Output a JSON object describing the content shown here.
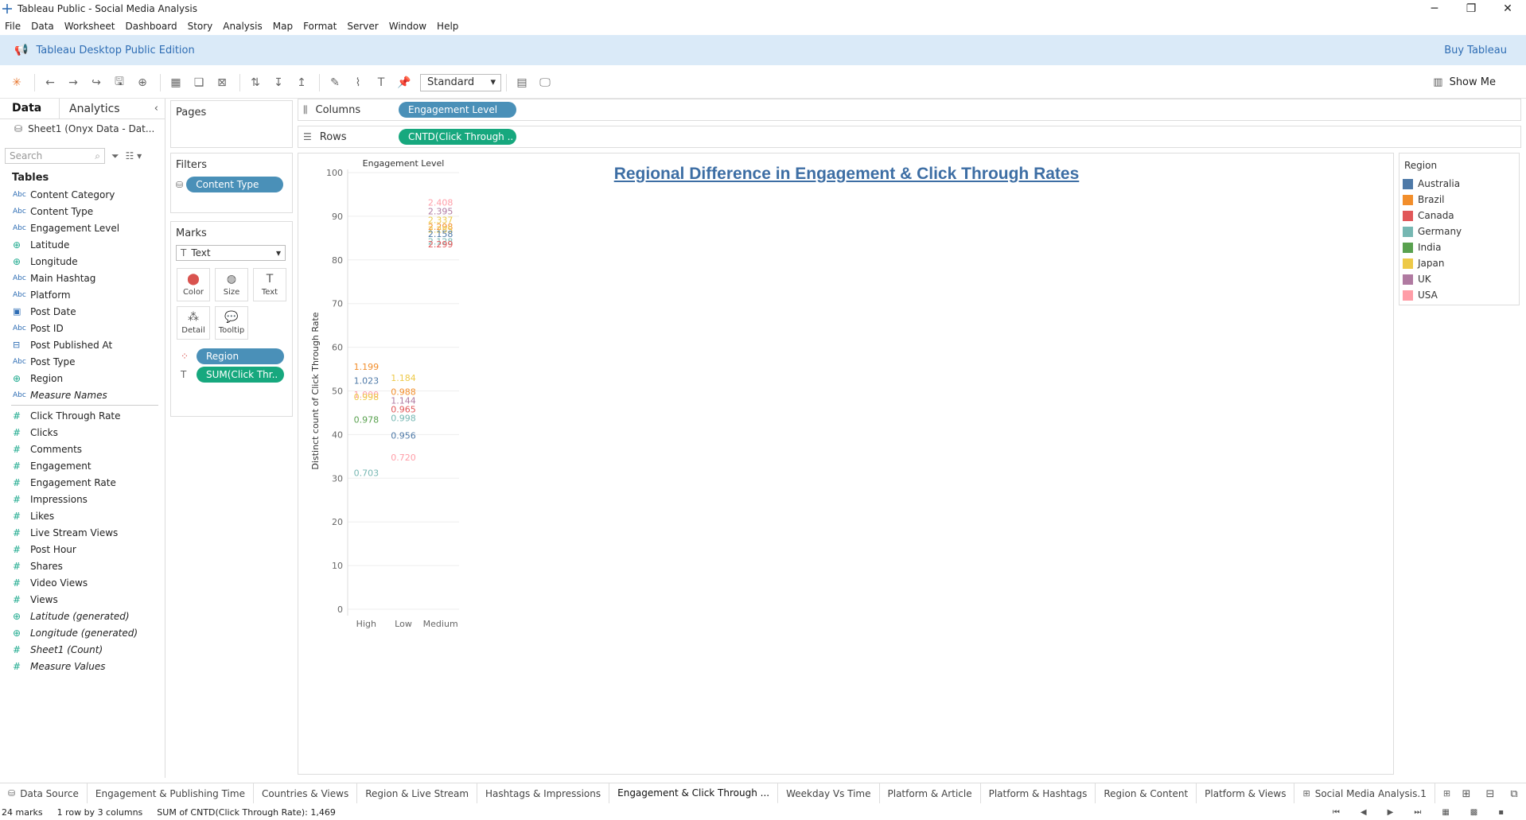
{
  "window": {
    "title": "Tableau Public - Social Media Analysis"
  },
  "menu": [
    "File",
    "Data",
    "Worksheet",
    "Dashboard",
    "Story",
    "Analysis",
    "Map",
    "Format",
    "Server",
    "Window",
    "Help"
  ],
  "banner": {
    "edition": "Tableau Desktop Public Edition",
    "buy": "Buy Tableau"
  },
  "toolbar": {
    "fit": "Standard",
    "show_me": "Show Me"
  },
  "left_pane": {
    "tab_data": "Data",
    "tab_analytics": "Analytics",
    "data_source": "Sheet1 (Onyx Data - Dat...",
    "search_placeholder": "Search",
    "tables_heading": "Tables",
    "dimensions": [
      {
        "type": "Abc",
        "name": "Content Category"
      },
      {
        "type": "Abc",
        "name": "Content Type"
      },
      {
        "type": "Abc",
        "name": "Engagement Level"
      },
      {
        "type": "geo",
        "name": "Latitude"
      },
      {
        "type": "geo",
        "name": "Longitude"
      },
      {
        "type": "Abc",
        "name": "Main Hashtag"
      },
      {
        "type": "Abc",
        "name": "Platform"
      },
      {
        "type": "date",
        "name": "Post Date"
      },
      {
        "type": "Abc",
        "name": "Post ID"
      },
      {
        "type": "datetime",
        "name": "Post Published At"
      },
      {
        "type": "Abc",
        "name": "Post Type"
      },
      {
        "type": "geo",
        "name": "Region"
      },
      {
        "type": "Abc",
        "name": "Measure Names",
        "italic": true
      }
    ],
    "measures": [
      {
        "type": "num",
        "name": "Click Through Rate"
      },
      {
        "type": "num",
        "name": "Clicks"
      },
      {
        "type": "num",
        "name": "Comments"
      },
      {
        "type": "num",
        "name": "Engagement"
      },
      {
        "type": "num",
        "name": "Engagement Rate"
      },
      {
        "type": "num",
        "name": "Impressions"
      },
      {
        "type": "num",
        "name": "Likes"
      },
      {
        "type": "num",
        "name": "Live Stream Views"
      },
      {
        "type": "num",
        "name": "Post Hour"
      },
      {
        "type": "num",
        "name": "Shares"
      },
      {
        "type": "num",
        "name": "Video Views"
      },
      {
        "type": "num",
        "name": "Views"
      },
      {
        "type": "geo",
        "name": "Latitude (generated)",
        "italic": true
      },
      {
        "type": "geo",
        "name": "Longitude (generated)",
        "italic": true
      },
      {
        "type": "num",
        "name": "Sheet1 (Count)",
        "italic": true
      },
      {
        "type": "num",
        "name": "Measure Values",
        "italic": true
      }
    ]
  },
  "pages": {
    "label": "Pages"
  },
  "filters": {
    "label": "Filters",
    "pill": "Content Type"
  },
  "marks": {
    "label": "Marks",
    "type": "Text",
    "buttons": [
      "Color",
      "Size",
      "Text",
      "Detail",
      "Tooltip"
    ],
    "pills": [
      {
        "icon": "color",
        "label": "Region",
        "color": "blue"
      },
      {
        "icon": "text",
        "label": "SUM(Click Thr..",
        "color": "green"
      }
    ]
  },
  "shelves": {
    "columns_label": "Columns",
    "columns_pill": "Engagement Level",
    "rows_label": "Rows",
    "rows_pill": "CNTD(Click Through .."
  },
  "view": {
    "title": "Regional Difference in Engagement & Click Through Rates"
  },
  "chart_data": {
    "type": "text",
    "column_header": "Engagement Level",
    "ylabel": "Distinct count of Click Through Rate",
    "categories": [
      "High",
      "Low",
      "Medium"
    ],
    "yticks": [
      0,
      10,
      20,
      30,
      40,
      50,
      60,
      70,
      80,
      90,
      100
    ],
    "ylim": [
      0,
      100
    ],
    "grid": true,
    "colors": {
      "Australia": "#4e79a7",
      "Brazil": "#f28e2b",
      "Canada": "#e15759",
      "Germany": "#76b7b2",
      "India": "#59a14f",
      "Japan": "#edc948",
      "UK": "#b07aa1",
      "USA": "#ff9da7"
    },
    "labels": [
      {
        "category": "High",
        "region": "Brazil",
        "y": 55.6,
        "text": "1.199"
      },
      {
        "category": "High",
        "region": "Australia",
        "y": 52.4,
        "text": "1.023"
      },
      {
        "category": "High",
        "region": "USA",
        "y": 49.2,
        "text": "1.000"
      },
      {
        "category": "High",
        "region": "Japan",
        "y": 48.6,
        "text": "0.998"
      },
      {
        "category": "High",
        "region": "India",
        "y": 43.4,
        "text": "0.978"
      },
      {
        "category": "High",
        "region": "Germany",
        "y": 31.2,
        "text": "0.703"
      },
      {
        "category": "Low",
        "region": "Japan",
        "y": 53.0,
        "text": "1.184"
      },
      {
        "category": "Low",
        "region": "Brazil",
        "y": 49.8,
        "text": "0.988"
      },
      {
        "category": "Low",
        "region": "UK",
        "y": 47.8,
        "text": "1.144"
      },
      {
        "category": "Low",
        "region": "Canada",
        "y": 45.8,
        "text": "0.965"
      },
      {
        "category": "Low",
        "region": "Germany",
        "y": 43.8,
        "text": "0.998"
      },
      {
        "category": "Low",
        "region": "Australia",
        "y": 39.8,
        "text": "0.956"
      },
      {
        "category": "Low",
        "region": "USA",
        "y": 34.8,
        "text": "0.720"
      },
      {
        "category": "Medium",
        "region": "USA",
        "y": 93.2,
        "text": "2.408"
      },
      {
        "category": "Medium",
        "region": "UK",
        "y": 91.2,
        "text": "2.395"
      },
      {
        "category": "Medium",
        "region": "Japan",
        "y": 89.2,
        "text": "2.337"
      },
      {
        "category": "Medium",
        "region": "Brazil",
        "y": 87.6,
        "text": "2.298"
      },
      {
        "category": "Medium",
        "region": "Japan",
        "y": 87.0,
        "text": "2.285"
      },
      {
        "category": "Medium",
        "region": "Australia",
        "y": 86.0,
        "text": "2.158"
      },
      {
        "category": "Medium",
        "region": "Germany",
        "y": 84.2,
        "text": "2.128"
      },
      {
        "category": "Medium",
        "region": "Canada",
        "y": 83.6,
        "text": "2.299"
      }
    ]
  },
  "legend": {
    "title": "Region",
    "items": [
      {
        "name": "Australia",
        "color": "#4e79a7"
      },
      {
        "name": "Brazil",
        "color": "#f28e2b"
      },
      {
        "name": "Canada",
        "color": "#e15759"
      },
      {
        "name": "Germany",
        "color": "#76b7b2"
      },
      {
        "name": "India",
        "color": "#59a14f"
      },
      {
        "name": "Japan",
        "color": "#edc948"
      },
      {
        "name": "UK",
        "color": "#b07aa1"
      },
      {
        "name": "USA",
        "color": "#ff9da7"
      }
    ]
  },
  "sheet_tabs": [
    {
      "label": "Data Source",
      "icon": "datasource"
    },
    {
      "label": "Engagement & Publishing Time"
    },
    {
      "label": "Countries & Views"
    },
    {
      "label": "Region & Live Stream"
    },
    {
      "label": "Hashtags & Impressions"
    },
    {
      "label": "Engagement & Click Through ...",
      "active": true
    },
    {
      "label": "Weekday Vs Time"
    },
    {
      "label": "Platform & Article"
    },
    {
      "label": "Platform & Hashtags"
    },
    {
      "label": "Region & Content"
    },
    {
      "label": "Platform & Views"
    },
    {
      "label": "Social Media Analysis.1",
      "icon": "dashboard"
    },
    {
      "label": "Social Media Analysis",
      "icon": "dashboard"
    }
  ],
  "status": {
    "marks": "24 marks",
    "dims": "1 row by 3 columns",
    "sum": "SUM of CNTD(Click Through Rate): 1,469"
  }
}
